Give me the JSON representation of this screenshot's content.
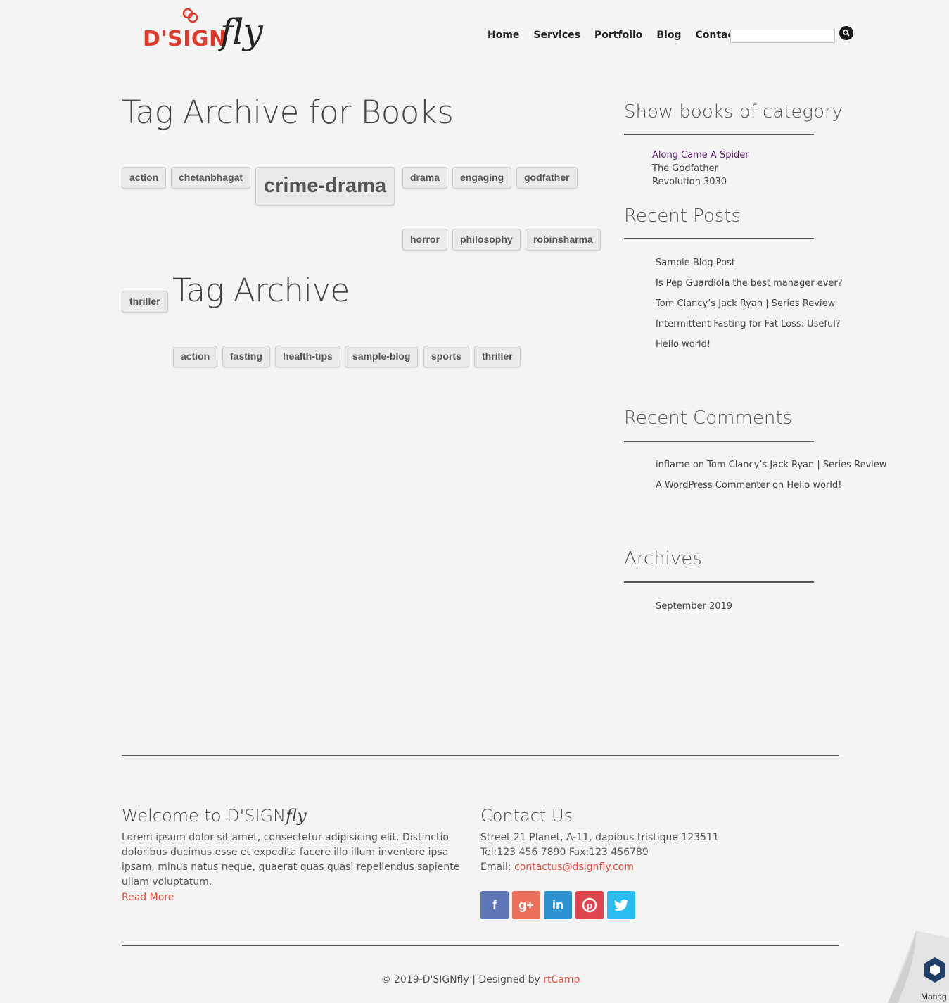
{
  "header": {
    "logo_main": "D'SIGN",
    "logo_fly": "fly",
    "nav": [
      "Home",
      "Services",
      "Portfolio",
      "Blog",
      "Contact"
    ],
    "search_placeholder": ""
  },
  "main": {
    "title": "Tag Archive for Books",
    "tags": [
      "action",
      "chetanbhagat",
      "crime-drama",
      "drama",
      "engaging",
      "godfather",
      "horror",
      "philosophy",
      "robinsharma",
      "thriller"
    ],
    "subtitle": "Tag Archive",
    "post_tags": [
      "action",
      "fasting",
      "health-tips",
      "sample-blog",
      "sports",
      "thriller"
    ]
  },
  "sidebar": {
    "categories_title": "Show books of category",
    "books": [
      "Along Came A Spider",
      "The Godfather",
      "Revolution 3030"
    ],
    "recent_posts_title": "Recent Posts",
    "recent_posts": [
      "Sample Blog Post",
      "Is Pep Guardiola the best manager ever?",
      "Tom Clancy’s Jack Ryan | Series Review",
      "Intermittent Fasting for Fat Loss: Useful?",
      "Hello world!"
    ],
    "recent_comments_title": "Recent Comments",
    "comments": [
      {
        "author": "inflame",
        "on": "on",
        "post": "Tom Clancy’s Jack Ryan | Series Review"
      },
      {
        "author": "A WordPress Commenter",
        "on": "on",
        "post": "Hello world!"
      }
    ],
    "archives_title": "Archives",
    "archives": [
      "September 2019"
    ]
  },
  "footer": {
    "welcome_title": "Welcome to D'SIGN",
    "welcome_fly": "fly",
    "welcome_text": "Lorem ipsum dolor sit amet, consectetur adipisicing elit. Distinctio doloribus ducimus esse et expedita facere illo illum inventore ipsa ipsam, minus natus neque, quaerat quas quasi repellendus sapiente ullam voluptatum.",
    "read_more": "Read More",
    "contact_title": "Contact Us",
    "address": "Street 21 Planet, A-11, dapibus tristique 123511",
    "phone": "Tel:123 456 7890 Fax:123 456789",
    "email_label": "Email:",
    "email": "contactus@dsignfly.com",
    "social": [
      {
        "name": "facebook-icon",
        "glyph": "f",
        "color": "#5c76b8"
      },
      {
        "name": "google-plus-icon",
        "glyph": "g+",
        "color": "#ec6f59"
      },
      {
        "name": "linkedin-icon",
        "glyph": "in",
        "color": "#2d93d0"
      },
      {
        "name": "pinterest-icon",
        "glyph": "P",
        "color": "#e0464e"
      },
      {
        "name": "twitter-icon",
        "glyph": "t",
        "color": "#2cbdf0"
      }
    ],
    "copyright": "© 2019-D'SIGNfly | Designed by",
    "designer": "rtCamp"
  },
  "corner_label": "Manag",
  "colors": {
    "accent": "#e03a2b",
    "link_visited": "#5a1a6e"
  }
}
